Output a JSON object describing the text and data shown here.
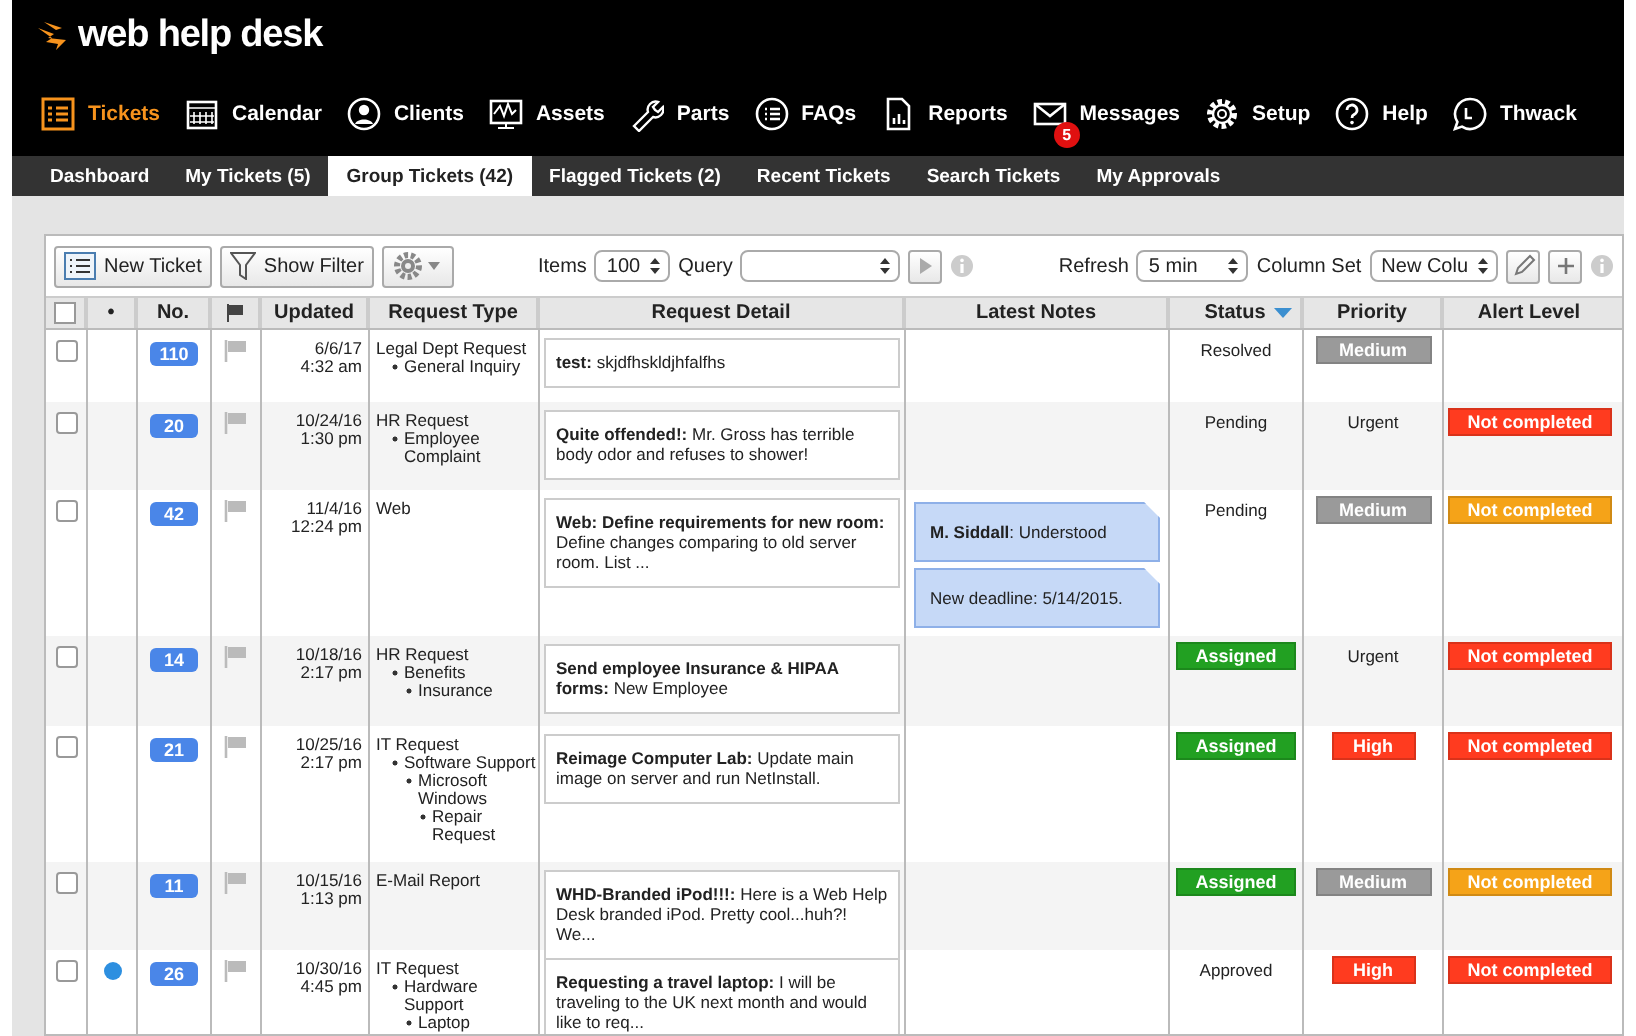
{
  "app": {
    "logo_text": "web help desk"
  },
  "nav": [
    {
      "label": "Tickets",
      "selected": true
    },
    {
      "label": "Calendar",
      "selected": false
    },
    {
      "label": "Clients",
      "selected": false
    },
    {
      "label": "Assets",
      "selected": false
    },
    {
      "label": "Parts",
      "selected": false
    },
    {
      "label": "FAQs",
      "selected": false
    },
    {
      "label": "Reports",
      "selected": false
    },
    {
      "label": "Messages",
      "selected": false,
      "badge": "5"
    },
    {
      "label": "Setup",
      "selected": false
    },
    {
      "label": "Help",
      "selected": false
    },
    {
      "label": "Thwack",
      "selected": false
    }
  ],
  "subtabs": [
    {
      "label": "Dashboard",
      "selected": false
    },
    {
      "label": "My Tickets (5)",
      "selected": false
    },
    {
      "label": "Group Tickets (42)",
      "selected": true
    },
    {
      "label": "Flagged Tickets (2)",
      "selected": false
    },
    {
      "label": "Recent Tickets",
      "selected": false
    },
    {
      "label": "Search Tickets",
      "selected": false
    },
    {
      "label": "My Approvals",
      "selected": false
    }
  ],
  "toolbar": {
    "new_ticket": "New Ticket",
    "show_filter": "Show Filter",
    "items_label": "Items",
    "items_value": "100",
    "query_label": "Query",
    "refresh_label": "Refresh",
    "refresh_value": "5 min",
    "column_set_label": "Column Set",
    "column_set_value": "New Colu"
  },
  "table": {
    "columns": [
      {
        "kind": "checkbox",
        "checked": false
      },
      {
        "kind": "text",
        "label": "•",
        "sorted": false
      },
      {
        "kind": "text",
        "label": "No.",
        "sorted": false
      },
      {
        "kind": "flag"
      },
      {
        "kind": "text",
        "label": "Updated",
        "sorted": false
      },
      {
        "kind": "text",
        "label": "Request Type",
        "sorted": false
      },
      {
        "kind": "text",
        "label": "Request Detail",
        "sorted": false
      },
      {
        "kind": "text",
        "label": "Latest Notes",
        "sorted": false
      },
      {
        "kind": "text",
        "label": "Status",
        "sorted": true
      },
      {
        "kind": "text",
        "label": "Priority",
        "sorted": false
      },
      {
        "kind": "text",
        "label": "Alert Level",
        "sorted": false
      }
    ],
    "rows": [
      {
        "checked": false,
        "unread": false,
        "number": "110",
        "flagged": false,
        "date": "6/6/17",
        "time": "4:32 am",
        "request_type": {
          "name": "Legal Dept Request",
          "children": [
            {
              "name": "General Inquiry"
            }
          ]
        },
        "detail": "**test:** skjdfhskldjhfalfhs",
        "notes": [],
        "status": {
          "kind": "text",
          "label": "Resolved"
        },
        "priority": {
          "kind": "badge",
          "label": "Medium",
          "color": "#9a9a9a"
        }
      },
      {
        "checked": false,
        "unread": false,
        "number": "20",
        "flagged": false,
        "date": "10/24/16",
        "time": "1:30 pm",
        "request_type": {
          "name": "HR Request",
          "children": [
            {
              "name": "Employee Complaint"
            }
          ]
        },
        "detail": "**Quite offended!:** Mr. Gross has terrible body odor and refuses to shower!",
        "notes": [],
        "status": {
          "kind": "text",
          "label": "Pending"
        },
        "priority": {
          "kind": "text",
          "label": "Urgent"
        },
        "alert": {
          "label": "Not completed",
          "color": "#ff3b1f"
        }
      },
      {
        "checked": false,
        "unread": false,
        "number": "42",
        "flagged": false,
        "date": "11/4/16",
        "time": "12:24 pm",
        "request_type": {
          "name": "Web"
        },
        "detail": "**Web: Define requirements for new room:** Define changes comparing to old server room. List ...",
        "notes": [
          "**M. Siddall**: Understood",
          "New deadline: 5/14/2015."
        ],
        "status": {
          "kind": "text",
          "label": "Pending"
        },
        "priority": {
          "kind": "badge",
          "label": "Medium",
          "color": "#9a9a9a"
        },
        "alert": {
          "label": "Not completed",
          "color": "#f5a318"
        }
      },
      {
        "checked": false,
        "unread": false,
        "number": "14",
        "flagged": false,
        "date": "10/18/16",
        "time": "2:17 pm",
        "request_type": {
          "name": "HR Request",
          "children": [
            {
              "name": "Benefits",
              "children": [
                {
                  "name": "Insurance"
                }
              ]
            }
          ]
        },
        "detail": "**Send employee Insurance & HIPAA forms:** New Employee",
        "notes": [],
        "status": {
          "kind": "badge",
          "label": "Assigned",
          "color": "#22a022"
        },
        "priority": {
          "kind": "text",
          "label": "Urgent"
        },
        "alert": {
          "label": "Not completed",
          "color": "#ff3b1f"
        }
      },
      {
        "checked": false,
        "unread": false,
        "number": "21",
        "flagged": false,
        "date": "10/25/16",
        "time": "2:17 pm",
        "request_type": {
          "name": "IT Request",
          "children": [
            {
              "name": "Software Support",
              "children": [
                {
                  "name": "Microsoft Windows",
                  "children": [
                    {
                      "name": "Repair Request"
                    }
                  ]
                }
              ]
            }
          ]
        },
        "detail": "**Reimage Computer Lab:** Update main image on server and run NetInstall.",
        "notes": [],
        "status": {
          "kind": "badge",
          "label": "Assigned",
          "color": "#22a022"
        },
        "priority": {
          "kind": "badge",
          "label": "High",
          "color": "#ff3b1f"
        },
        "alert": {
          "label": "Not completed",
          "color": "#ff3b1f"
        }
      },
      {
        "checked": false,
        "unread": false,
        "number": "11",
        "flagged": false,
        "date": "10/15/16",
        "time": "1:13 pm",
        "request_type": {
          "name": "E-Mail Report"
        },
        "detail": "**WHD-Branded iPod!!!:** Here is a Web Help Desk branded iPod. Pretty cool...huh?! We...",
        "notes": [],
        "status": {
          "kind": "badge",
          "label": "Assigned",
          "color": "#22a022"
        },
        "priority": {
          "kind": "badge",
          "label": "Medium",
          "color": "#9a9a9a"
        },
        "alert": {
          "label": "Not completed",
          "color": "#f5a318"
        }
      },
      {
        "checked": false,
        "unread": true,
        "number": "26",
        "flagged": false,
        "date": "10/30/16",
        "time": "4:45 pm",
        "request_type": {
          "name": "IT Request",
          "children": [
            {
              "name": "Hardware Support",
              "children": [
                {
                  "name": "Laptop"
                }
              ]
            }
          ]
        },
        "detail": "**Requesting a travel laptop:** I will be traveling to the UK next month and would like to req...",
        "notes": [],
        "status": {
          "kind": "text",
          "label": "Approved"
        },
        "priority": {
          "kind": "badge",
          "label": "High",
          "color": "#ff3b1f"
        },
        "alert": {
          "label": "Not completed",
          "color": "#ff3b1f"
        }
      }
    ]
  }
}
